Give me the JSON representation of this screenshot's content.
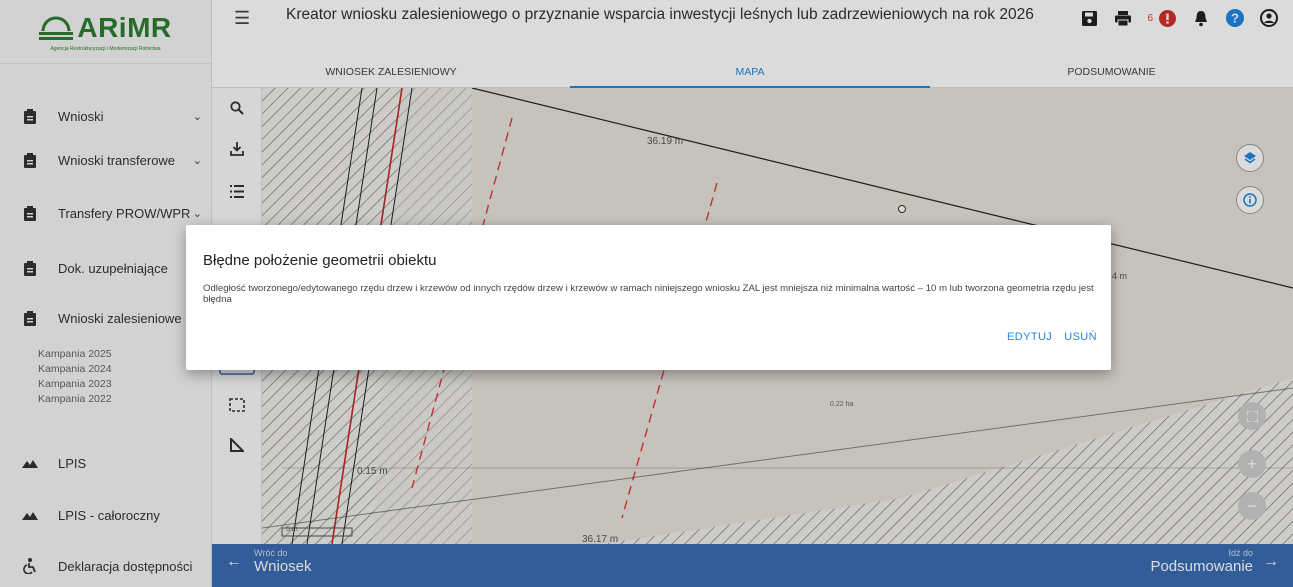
{
  "app": {
    "logo_text": "ARiMR",
    "logo_subtitle": "Agencja Restrukturyzacji i Modernizacji Rolnictwa"
  },
  "sidebar": {
    "items": [
      {
        "label": "Wnioski",
        "icon": "clipboard-icon",
        "chevron": true
      },
      {
        "label": "Wnioski transferowe",
        "icon": "clipboard-icon",
        "chevron": true
      },
      {
        "label": "Transfery PROW/WPR",
        "icon": "clipboard-icon",
        "chevron": true
      },
      {
        "label": "Dok. uzupełniające",
        "icon": "clipboard-icon",
        "chevron": false
      },
      {
        "label": "Wnioski zalesieniowe",
        "icon": "clipboard-icon",
        "chevron": false
      },
      {
        "label": "LPIS",
        "icon": "terrain-icon",
        "chevron": false
      },
      {
        "label": "LPIS - całoroczny",
        "icon": "terrain-icon",
        "chevron": false
      },
      {
        "label": "Deklaracja dostępności",
        "icon": "accessibility-icon",
        "chevron": false
      }
    ],
    "campaigns": [
      "Kampania 2025",
      "Kampania 2024",
      "Kampania 2023",
      "Kampania 2022"
    ]
  },
  "header": {
    "title": "Kreator wniosku zalesieniowego o przyznanie wsparcia inwestycji leśnych lub zadrzewieniowych na rok 2026",
    "notification_count": "6",
    "icons": [
      "save-icon",
      "print-icon",
      "error-icon",
      "bell-icon",
      "help-icon",
      "account-icon"
    ]
  },
  "tabs": [
    {
      "label": "WNIOSEK ZALESIENIOWY",
      "active": false
    },
    {
      "label": "MAPA",
      "active": true
    },
    {
      "label": "PODSUMOWANIE",
      "active": false
    }
  ],
  "map": {
    "labels": {
      "top_length": "36.19 m",
      "left_length": "0.15 m",
      "bottom_length": "36.17 m",
      "area": "0.22 ha",
      "right_length": "4 m",
      "scale": "5 m"
    },
    "tools": [
      "search-icon",
      "download-icon",
      "list-icon",
      "select-icon",
      "rectangle-select-icon",
      "measure-icon"
    ],
    "controls": [
      "layers-icon",
      "info-icon",
      "fullscreen-icon",
      "zoom-in-icon",
      "zoom-out-icon"
    ]
  },
  "footer": {
    "back_small": "Wróć do",
    "back_label": "Wniosek",
    "next_small": "Idź do",
    "next_label": "Podsumowanie"
  },
  "dialog": {
    "title": "Błędne położenie geometrii obiektu",
    "message": "Odległość tworzonego/edytowanego rzędu drzew i krzewów od innych rzędów drzew i krzewów w ramach niniejszego wniosku ZAL jest mniejsza niż minimalna wartość – 10 m lub tworzona geometria rzędu jest błędna",
    "edit_label": "EDYTUJ",
    "delete_label": "USUŃ"
  },
  "colors": {
    "accent": "#1e88e5",
    "bottom_bar": "#3b6db3",
    "brand": "#2e7d32",
    "error": "#e53935"
  }
}
